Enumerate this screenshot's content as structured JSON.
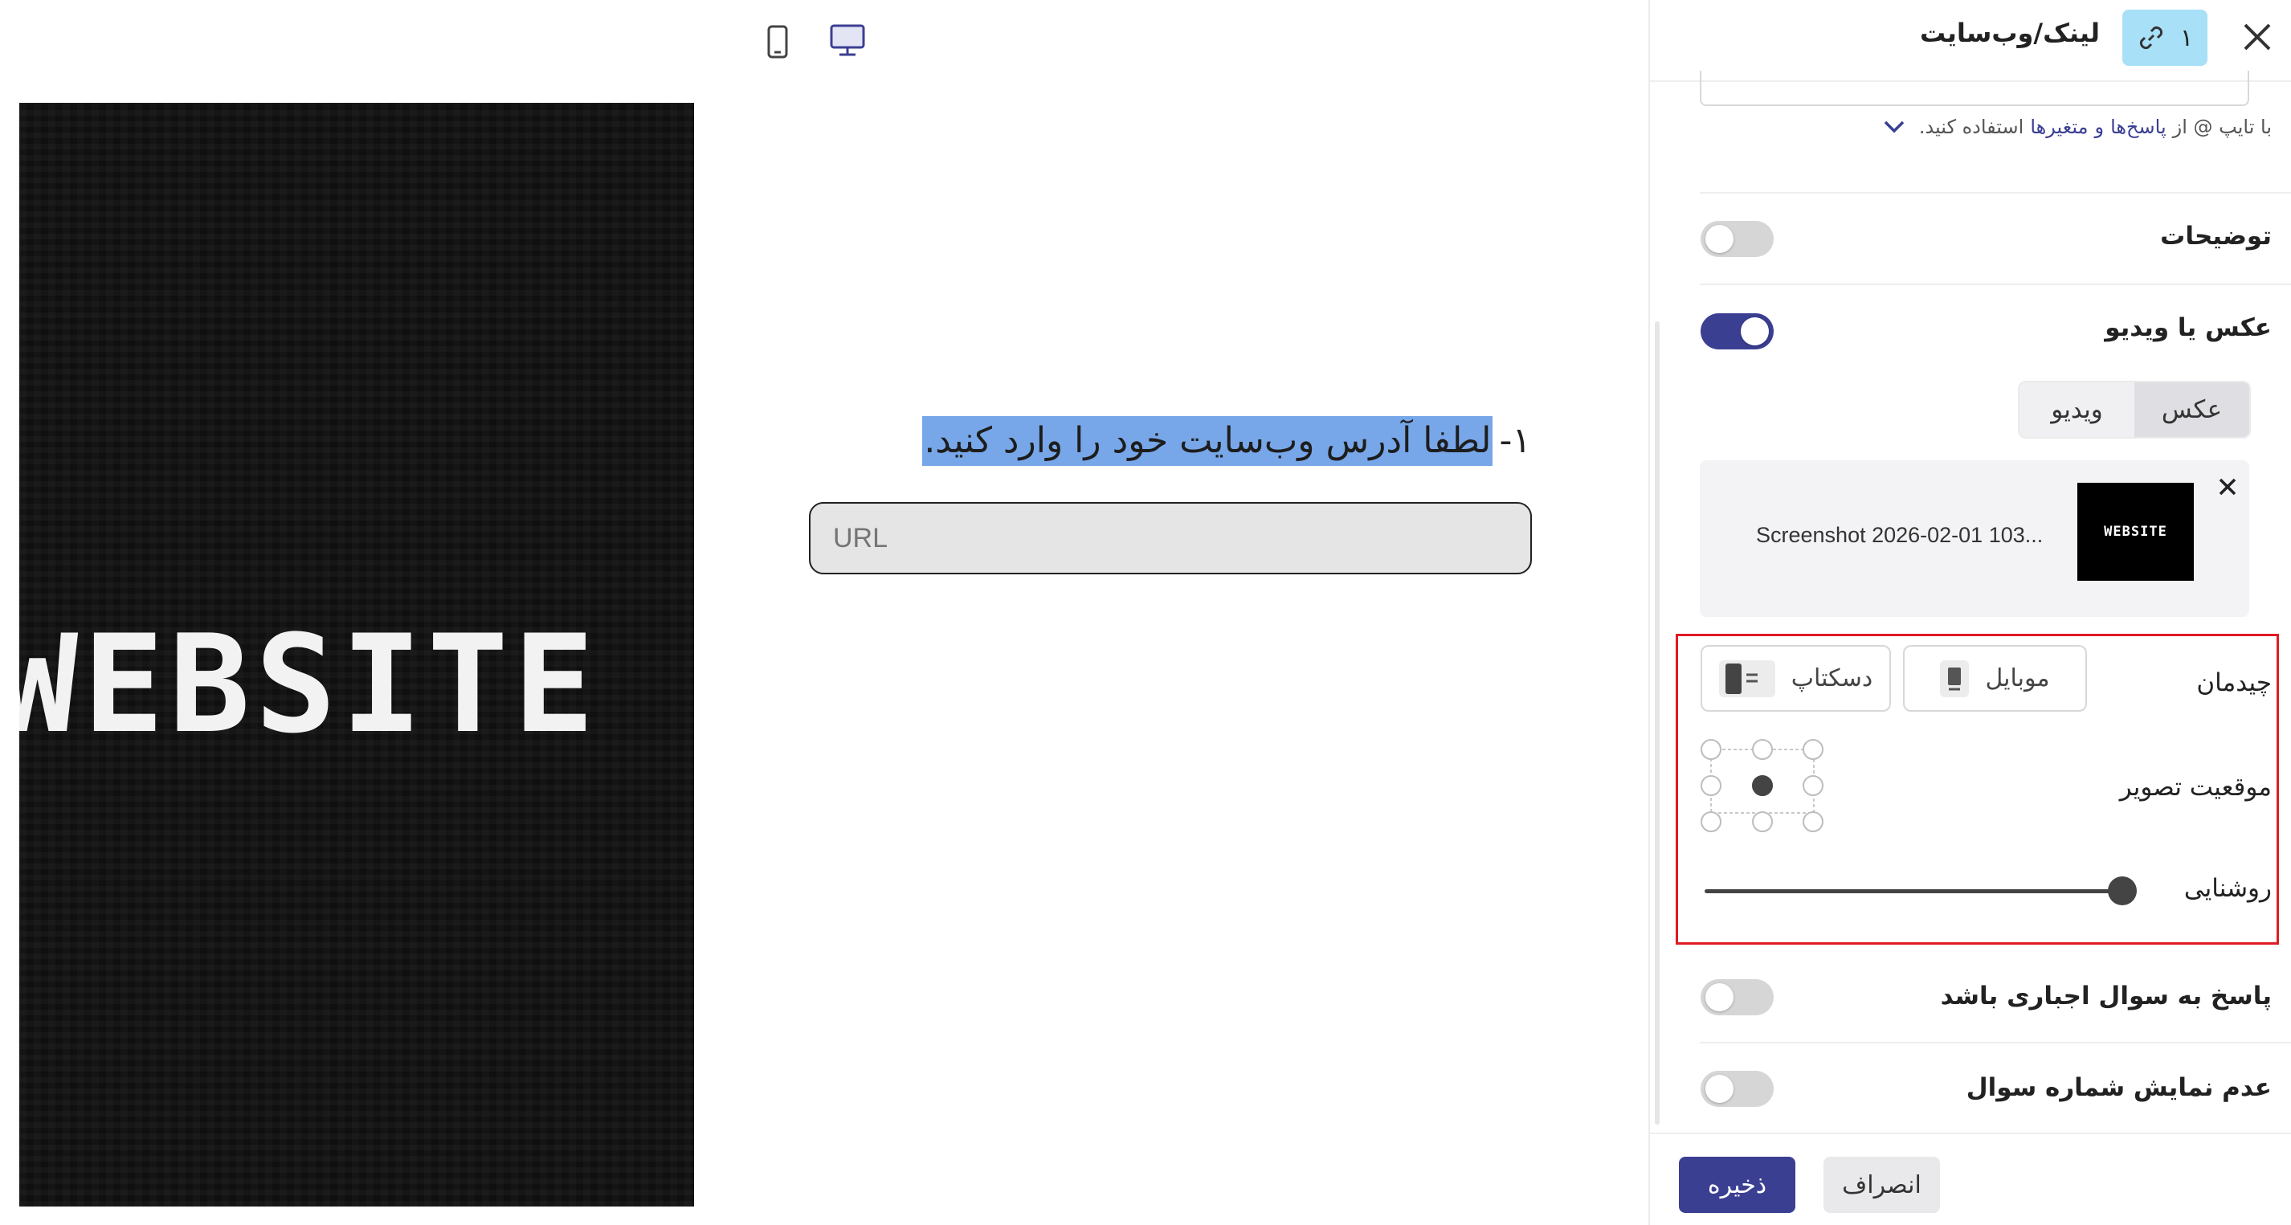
{
  "preview": {
    "question_number": "۱-",
    "question_text": "لطفا آدرس وب‌سایت خود را وارد کنید.",
    "input_placeholder": "URL",
    "image_word": "WEBSITE",
    "device_icons": [
      "mobile-icon",
      "desktop-icon"
    ],
    "selected_device": "desktop"
  },
  "panel": {
    "header": {
      "title": "لینک/وب‌سایت",
      "badge_number": "۱",
      "badge_icon": "link-icon",
      "close_icon": "close-icon"
    },
    "variables_hint": {
      "prefix": "با تایپ @ از",
      "link1": "پاسخ‌ها",
      "conjunction": "و",
      "link2": "متغیرها",
      "suffix": "استفاده کنید."
    },
    "description": {
      "label": "توضیحات",
      "enabled": false
    },
    "media": {
      "label": "عکس یا ویدیو",
      "enabled": true,
      "tabs": [
        "عکس",
        "ویدیو"
      ],
      "selected_tab": "عکس",
      "file_name": "Screenshot 2026-02-01 103...",
      "thumbnail_text": "WEBSITE"
    },
    "layout": {
      "label": "چیدمان",
      "options": [
        "موبایل",
        "دسکتاپ"
      ]
    },
    "image_position": {
      "label": "موقعیت تصویر",
      "selected": "center"
    },
    "brightness": {
      "label": "روشنایی",
      "value": 1.0
    },
    "required": {
      "label": "پاسخ به سوال اجباری باشد",
      "enabled": false
    },
    "hide_number": {
      "label": "عدم نمایش شماره سوال",
      "enabled": false
    },
    "footer": {
      "save": "ذخیره",
      "cancel": "انصراف"
    }
  },
  "colors": {
    "accent": "#3b3f92",
    "highlight": "#77a7e8",
    "badge_bg": "#a7e0f7",
    "annotation_box": "#e01b23"
  }
}
